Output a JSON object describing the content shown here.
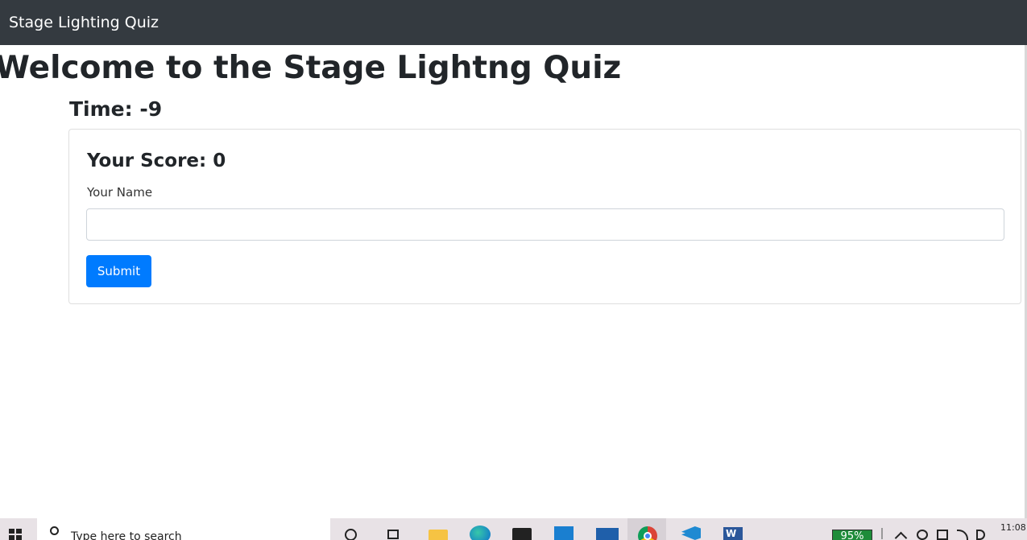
{
  "navbar": {
    "brand": "Stage Lighting Quiz"
  },
  "main": {
    "heading": "Welcome to the Stage Lightng Quiz",
    "timer": "Time: -9",
    "card": {
      "score": "Your Score: 0",
      "name_label": "Your Name",
      "name_value": "",
      "submit_label": "Submit"
    }
  },
  "taskbar": {
    "search_placeholder": "Type here to search",
    "battery": "95%",
    "clock": "11:08",
    "icons": [
      "windows-start-icon",
      "search-icon",
      "cortana-icon",
      "task-view-icon",
      "file-explorer-icon",
      "edge-icon",
      "store-icon",
      "app-icon",
      "mail-icon",
      "chrome-icon",
      "vscode-icon",
      "word-icon",
      "plug-icon",
      "chevron-up-icon",
      "globe-icon",
      "meet-icon",
      "wifi-icon",
      "volume-icon"
    ]
  },
  "colors": {
    "navbar_bg": "#343a40",
    "primary_button": "#007bff",
    "battery_fill": "#1e8c3a"
  }
}
